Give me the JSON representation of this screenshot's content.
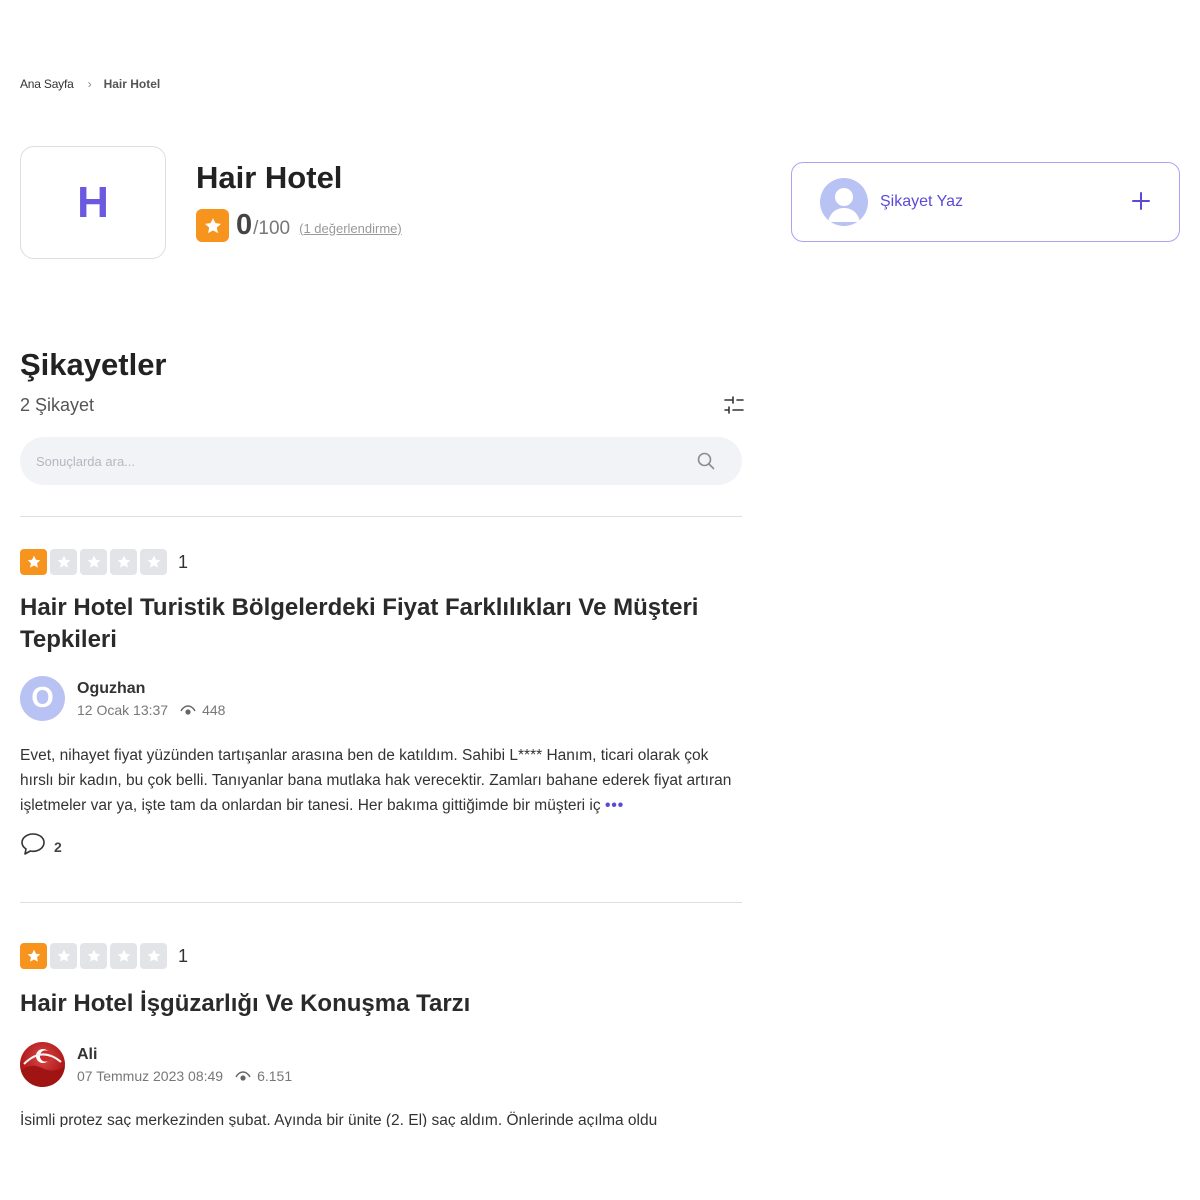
{
  "breadcrumb": {
    "home": "Ana Sayfa",
    "current": "Hair Hotel"
  },
  "brand": {
    "logo_letter": "H",
    "name": "Hair Hotel",
    "score": "0",
    "score_max": "/100",
    "rating_count": "(1 değerlendirme)"
  },
  "write_card": {
    "label": "Şikayet Yaz",
    "plus_icon": "plus-icon"
  },
  "section": {
    "title": "Şikayetler",
    "count": "2 Şikayet"
  },
  "search": {
    "placeholder": "Sonuçlarda ara..."
  },
  "colors": {
    "accent": "#5b4ad8",
    "star": "#f7941d",
    "star_off": "#e3e4e8"
  },
  "complaints": [
    {
      "rating": 1,
      "rating_label": "1",
      "title": "Hair Hotel Turistik Bölgelerdeki Fiyat Farklılıkları Ve Müşteri Tepkileri",
      "author": "Oguzhan",
      "avatar_letter": "O",
      "date": "12 Ocak 13:37",
      "views": "448",
      "body": "Evet, nihayet fiyat yüzünden tartışanlar arasına ben de katıldım. Sahibi L**** Hanım, ticari olarak çok hırslı bir kadın, bu çok belli. Tanıyanlar bana mutlaka hak verecektir. Zamları bahane ederek fiyat artıran işletmeler var ya, işte tam da onlardan bir tanesi. Her bakıma gittiğimde bir müşteri iç",
      "more": "•••",
      "comments": "2"
    },
    {
      "rating": 1,
      "rating_label": "1",
      "title": "Hair Hotel İşgüzarlığı Ve Konuşma Tarzı",
      "author": "Ali",
      "date": "07 Temmuz 2023 08:49",
      "views": "6.151",
      "body": "İsimli protez saç merkezinden şubat. Ayında bir ünite (2. El) saç aldım. Önlerinde açılma oldu"
    }
  ]
}
